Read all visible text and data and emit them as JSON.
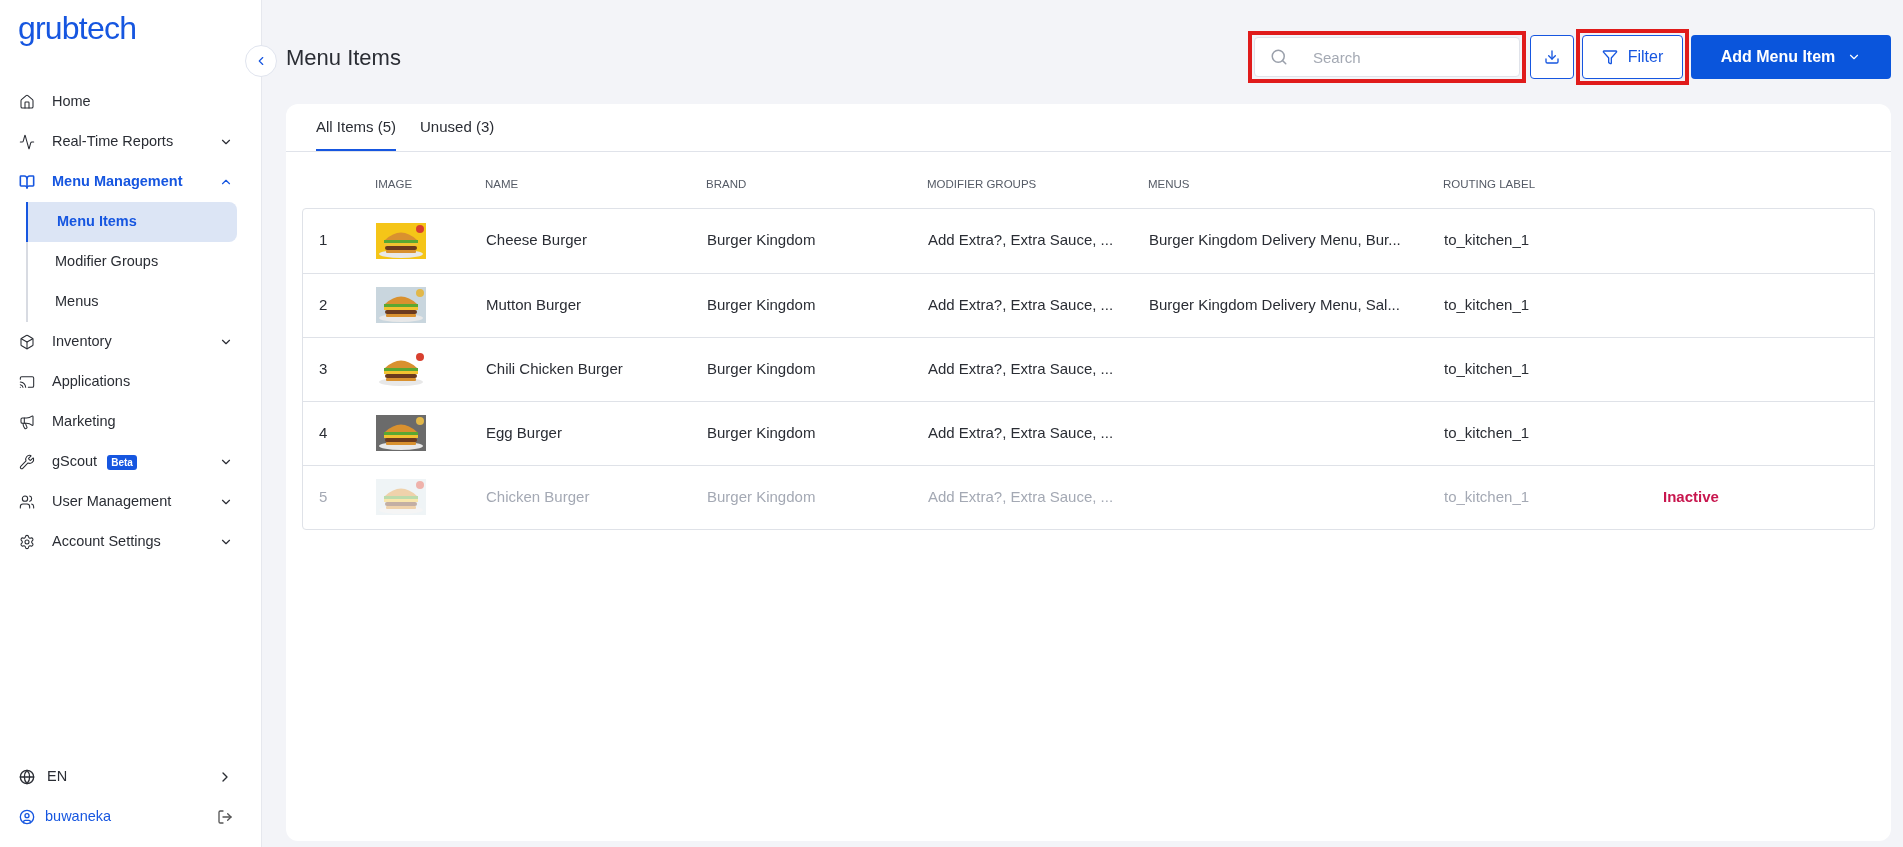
{
  "sidebar": {
    "logo": "grubtech",
    "items": [
      {
        "label": "Home",
        "expandable": false,
        "selected": false
      },
      {
        "label": "Real-Time Reports",
        "expandable": true,
        "expanded": false,
        "selected": false
      },
      {
        "label": "Menu Management",
        "expandable": true,
        "expanded": true,
        "selected": true,
        "children": [
          {
            "label": "Menu Items",
            "selected": true
          },
          {
            "label": "Modifier Groups",
            "selected": false
          },
          {
            "label": "Menus",
            "selected": false
          }
        ]
      },
      {
        "label": "Inventory",
        "expandable": true,
        "expanded": false,
        "selected": false
      },
      {
        "label": "Applications",
        "expandable": false,
        "selected": false
      },
      {
        "label": "Marketing",
        "expandable": false,
        "selected": false
      },
      {
        "label": "gScout",
        "badge": "Beta",
        "expandable": true,
        "expanded": false,
        "selected": false
      },
      {
        "label": "User Management",
        "expandable": true,
        "expanded": false,
        "selected": false
      },
      {
        "label": "Account Settings",
        "expandable": true,
        "expanded": false,
        "selected": false
      }
    ],
    "language": "EN",
    "user": "buwaneka"
  },
  "header": {
    "title": "Menu Items",
    "search": {
      "placeholder": "Search",
      "highlighted": true
    },
    "filter": {
      "label": "Filter",
      "highlighted": true
    },
    "add_button": "Add Menu Item"
  },
  "tabs": [
    {
      "label": "All Items (5)",
      "selected": true
    },
    {
      "label": "Unused (3)",
      "selected": false
    }
  ],
  "table": {
    "columns": [
      "IMAGE",
      "NAME",
      "BRAND",
      "MODIFIER GROUPS",
      "MENUS",
      "ROUTING LABEL"
    ],
    "rows": [
      {
        "index": "1",
        "name": "Cheese Burger",
        "brand": "Burger Kingdom",
        "modifier_groups": "Add Extra?, Extra Sauce, ...",
        "menus": "Burger Kingdom Delivery Menu, Bur...",
        "routing_label": "to_kitchen_1",
        "active": true
      },
      {
        "index": "2",
        "name": "Mutton Burger",
        "brand": "Burger Kingdom",
        "modifier_groups": "Add Extra?, Extra Sauce, ...",
        "menus": "Burger Kingdom Delivery Menu, Sal...",
        "routing_label": "to_kitchen_1",
        "active": true
      },
      {
        "index": "3",
        "name": "Chili Chicken Burger",
        "brand": "Burger Kingdom",
        "modifier_groups": "Add Extra?, Extra Sauce, ...",
        "routing_label": "to_kitchen_1",
        "active": true
      },
      {
        "index": "4",
        "name": "Egg Burger",
        "brand": "Burger Kingdom",
        "modifier_groups": "Add Extra?, Extra Sauce, ...",
        "routing_label": "to_kitchen_1",
        "active": true
      },
      {
        "index": "5",
        "name": "Chicken Burger",
        "brand": "Burger Kingdom",
        "modifier_groups": "Add Extra?, Extra Sauce, ...",
        "routing_label": "to_kitchen_1",
        "active": false,
        "status": "Inactive"
      }
    ]
  }
}
